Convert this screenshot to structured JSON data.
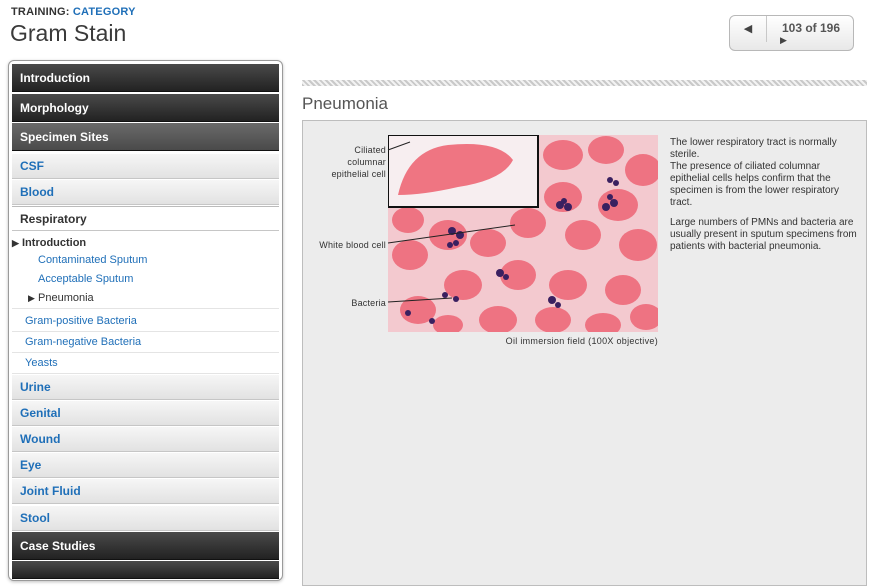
{
  "header": {
    "training_label": "TRAINING:",
    "category_link": "CATEGORY",
    "page_title": "Gram Stain"
  },
  "pager": {
    "prev_symbol": "◀",
    "next_symbol": "▶",
    "current": "103",
    "total": "196",
    "counter_text": "103 of 196"
  },
  "sidebar": {
    "introduction": "Introduction",
    "morphology": "Morphology",
    "specimen_sites": "Specimen Sites",
    "csf": "CSF",
    "blood": "Blood",
    "respiratory": "Respiratory",
    "resp_intro": "Introduction",
    "contaminated": "Contaminated Sputum",
    "acceptable": "Acceptable Sputum",
    "pneumonia": "Pneumonia",
    "gram_positive": "Gram-positive Bacteria",
    "gram_negative": "Gram-negative Bacteria",
    "yeasts": "Yeasts",
    "urine": "Urine",
    "genital": "Genital",
    "wound": "Wound",
    "eye": "Eye",
    "joint_fluid": "Joint Fluid",
    "stool": "Stool",
    "case_studies": "Case Studies"
  },
  "content": {
    "section_title": "Pneumonia",
    "label_ciliated": "Ciliated columnar epithelial cell",
    "label_wbc": "White blood cell",
    "label_bacteria": "Bacteria",
    "caption": "Oil immersion field (100X objective)",
    "para1": "The lower respiratory tract is normally sterile.",
    "para2": "The presence of ciliated columnar epithelial cells helps confirm that the specimen is from the lower respiratory tract.",
    "para3": "Large numbers of PMNs and bacteria are usually present in sputum specimens from patients with bacterial pneumonia."
  },
  "colors": {
    "link_blue": "#1f6fb8",
    "nav_dark": "#2a2a2a",
    "panel_bg": "#ececec",
    "stain_pink": "#ee6a7a",
    "stain_purple": "#3a2060"
  }
}
